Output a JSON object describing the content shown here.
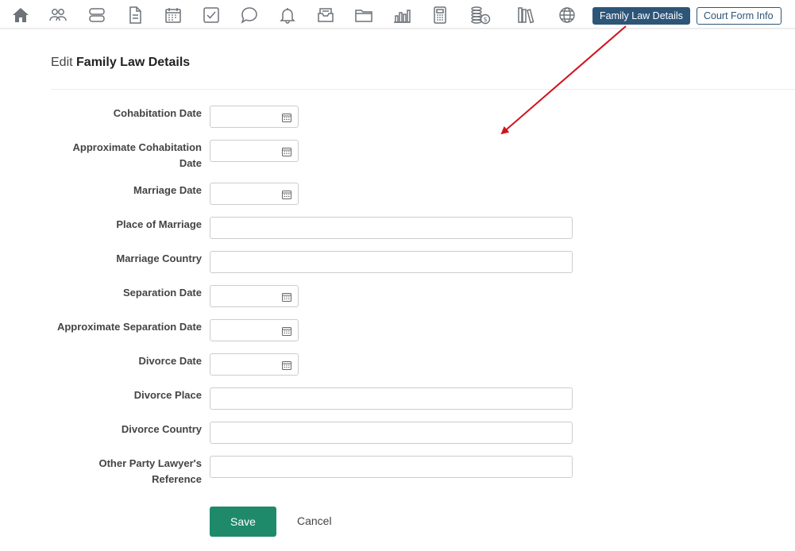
{
  "toolbar": {
    "icons": [
      {
        "name": "home-icon"
      },
      {
        "name": "contacts-icon"
      },
      {
        "name": "matters-icon"
      },
      {
        "name": "document-icon"
      },
      {
        "name": "calendar-icon"
      },
      {
        "name": "tasks-icon"
      },
      {
        "name": "messages-icon"
      },
      {
        "name": "notifications-icon"
      },
      {
        "name": "inbox-icon"
      },
      {
        "name": "folder-icon"
      },
      {
        "name": "reports-icon"
      },
      {
        "name": "calculator-icon"
      },
      {
        "name": "billing-icon"
      },
      {
        "name": "library-icon"
      },
      {
        "name": "globe-icon"
      }
    ],
    "tabs": {
      "active_label": "Family Law Details",
      "inactive_label": "Court Form Info"
    },
    "colors": {
      "tab_active_bg": "#2d5578",
      "icon_gray": "#6d7278"
    }
  },
  "page": {
    "title_prefix": "Edit",
    "title_main": "Family Law Details"
  },
  "form": {
    "fields": [
      {
        "label": "Cohabitation Date",
        "type": "date",
        "value": ""
      },
      {
        "label_line1": "Approximate Cohabitation",
        "label_line2": "Date",
        "type": "date",
        "value": ""
      },
      {
        "label": "Marriage Date",
        "type": "date",
        "value": ""
      },
      {
        "label": "Place of Marriage",
        "type": "text",
        "value": ""
      },
      {
        "label": "Marriage Country",
        "type": "text",
        "value": ""
      },
      {
        "label": "Separation Date",
        "type": "date",
        "value": ""
      },
      {
        "label": "Approximate Separation Date",
        "type": "date",
        "value": ""
      },
      {
        "label": "Divorce Date",
        "type": "date",
        "value": ""
      },
      {
        "label": "Divorce Place",
        "type": "text",
        "value": ""
      },
      {
        "label": "Divorce Country",
        "type": "text",
        "value": ""
      },
      {
        "label_line1": "Other Party Lawyer's",
        "label_line2": "Reference",
        "type": "text",
        "value": ""
      }
    ],
    "save_label": "Save",
    "cancel_label": "Cancel",
    "colors": {
      "save_bg": "#1f8a6a"
    }
  },
  "annotation": {
    "arrow_color": "#d0141f"
  }
}
